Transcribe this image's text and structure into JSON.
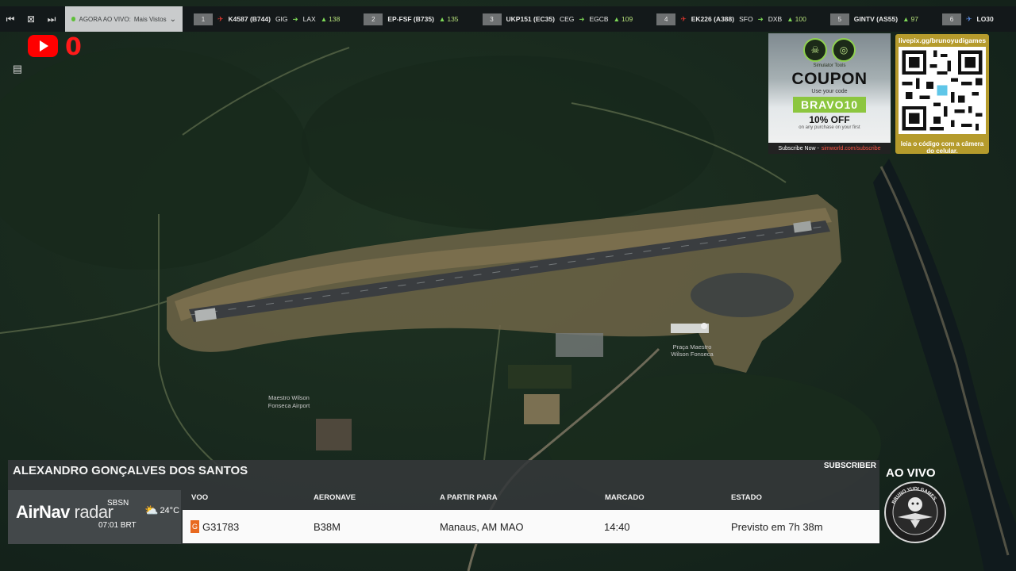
{
  "ticker": {
    "live_label": "AGORA AO VIVO:",
    "live_filter": "Mais Vistos",
    "flights": [
      {
        "rank": "1",
        "callsign": "K4587 (B744)",
        "origin": "GIG",
        "dest": "LAX",
        "alt": "138"
      },
      {
        "rank": "2",
        "callsign": "EP-FSF (B735)",
        "origin": "",
        "dest": "",
        "alt": "135"
      },
      {
        "rank": "3",
        "callsign": "UKP151 (EC35)",
        "origin": "CEG",
        "dest": "EGCB",
        "alt": "109"
      },
      {
        "rank": "4",
        "callsign": "EK226 (A388)",
        "origin": "SFO",
        "dest": "DXB",
        "alt": "100"
      },
      {
        "rank": "5",
        "callsign": "GINTV (AS55)",
        "origin": "",
        "dest": "",
        "alt": "97"
      },
      {
        "rank": "6",
        "callsign": "LO30",
        "origin": "",
        "dest": "",
        "alt": ""
      }
    ]
  },
  "youtube": {
    "count": "0"
  },
  "map": {
    "airport_label_1": "Maestro Wilson",
    "airport_label_2": "Fonseca Airport",
    "terminal_label_1": "Praça Maestro",
    "terminal_label_2": "Wilson Fonseca"
  },
  "coupon": {
    "brand": "Simulator Tools",
    "title": "COUPON",
    "subtitle": "Use your code",
    "code": "BRAVO10",
    "discount": "10% OFF",
    "fine_print": "on any purchase on your first",
    "footer_label": "Subscribe Now -",
    "footer_url": "simworld.com/subscribe"
  },
  "qr": {
    "url": "livepix.gg/brunoyudigames",
    "caption": "leia o código com a câmera do celular."
  },
  "bottom": {
    "pilot": "ALEXANDRO GONÇALVES DOS SANTOS",
    "subscriber": "SUBSCRIBER",
    "brand_main": "AirNav",
    "brand_sub": "radar",
    "icao": "SBSN",
    "local_time": "07:01 BRT",
    "temperature": "24°C",
    "headers": {
      "flight": "VOO",
      "aircraft": "AERONAVE",
      "departing_to": "A PARTIR PARA",
      "scheduled": "MARCADO",
      "status": "ESTADO"
    },
    "row": {
      "flight": "G31783",
      "aircraft": "B38M",
      "departing_to": "Manaus, AM MAO",
      "scheduled": "14:40",
      "status": "Previsto em 7h 38m"
    }
  },
  "badge": {
    "live": "AO VIVO",
    "ring_text": "BRUNO YUDI GAMES"
  },
  "colors": {
    "live_red": "#ff1a1a",
    "coupon_green": "#8cc63f",
    "qr_gold": "#b59b2c",
    "ticker_alt": "#7ed957"
  }
}
